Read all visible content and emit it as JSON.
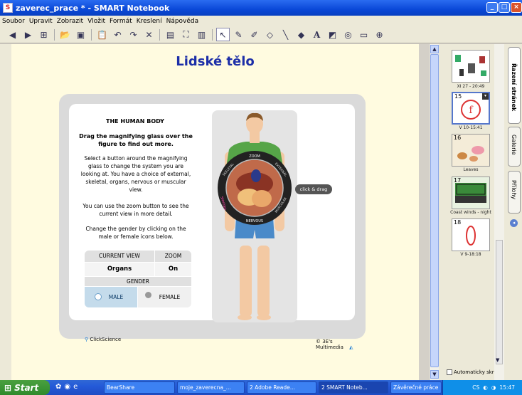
{
  "window": {
    "title": "zaverec_prace * - SMART Notebook"
  },
  "menu": [
    "Soubor",
    "Upravit",
    "Zobrazit",
    "Vložit",
    "Formát",
    "Kreslení",
    "Nápověda"
  ],
  "page": {
    "title": "Lidské tělo"
  },
  "activity": {
    "heading": "THE HUMAN BODY",
    "instruction": "Drag the magnifying glass over the figure to find out more.",
    "para1": "Select a button around the magnifying glass to change the system you are looking at. You have a choice of external, skeletal, organs, nervous or muscular view.",
    "para2": "You can use the zoom button to see the current view in more detail.",
    "para3": "Change the gender by clicking on the male or female icons below.",
    "table": {
      "current_view_label": "CURRENT VIEW",
      "zoom_label": "ZOOM",
      "current_view_value": "Organs",
      "zoom_value": "On",
      "gender_label": "GENDER",
      "male": "MALE",
      "female": "FEMALE"
    },
    "ring": {
      "zoom": "ZOOM",
      "external": "EXTERNAL",
      "skeletal": "SKELETAL",
      "organs": "ORGANS",
      "nervous": "NERVOUS",
      "muscular": "MUSCULAR"
    },
    "drag_hint": "click & drag",
    "footer_left": "ClickScience",
    "footer_right": "© 3E's Multimedia"
  },
  "sorter": {
    "pages": [
      {
        "num": "",
        "label": "XI 27 - 20:49"
      },
      {
        "num": "15",
        "label": "V 10-15:41"
      },
      {
        "num": "16",
        "label": "Leaves"
      },
      {
        "num": "17",
        "label": "Coast winds - night"
      },
      {
        "num": "18",
        "label": "V 9-18:18"
      }
    ],
    "autohide": "Automaticky skrýt"
  },
  "side_tabs": [
    "Řazení stránek",
    "Galerie",
    "Přílohy"
  ],
  "taskbar": {
    "start": "Start",
    "tasks": [
      "BearShare",
      "moje_zaverecna_...",
      "2 Adobe Reade...",
      "2 SMART Noteb...",
      "Závěrečné práce"
    ],
    "lang": "CS",
    "time": "15:47"
  }
}
